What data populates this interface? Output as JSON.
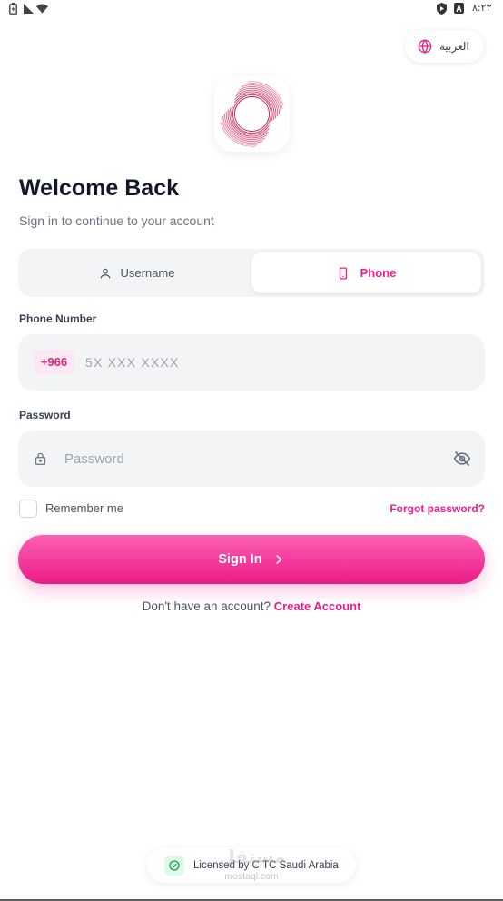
{
  "status_bar": {
    "time": "٨:٢٣",
    "left_icons": [
      "battery-charging-icon",
      "signal-icon",
      "wifi-icon"
    ],
    "right_icons": [
      "play-protect-icon",
      "autofill-icon"
    ]
  },
  "language_button": {
    "label": "العربية",
    "icon": "globe-icon"
  },
  "logo": {
    "icon": "swirl-logo-icon"
  },
  "header": {
    "title": "Welcome Back",
    "subtitle": "Sign in to continue to your account"
  },
  "login_tabs": [
    {
      "label": "Username",
      "icon": "user-icon",
      "active": false
    },
    {
      "label": "Phone",
      "icon": "smartphone-icon",
      "active": true
    }
  ],
  "phone_field": {
    "label": "Phone Number",
    "country_code": "+966",
    "placeholder": "5X XXX XXXX",
    "value": ""
  },
  "password_field": {
    "label": "Password",
    "placeholder": "Password",
    "value": "",
    "leading_icon": "lock-icon",
    "toggle_icon": "eye-off-icon"
  },
  "remember_me": {
    "label": "Remember me",
    "checked": false
  },
  "forgot_password": {
    "label": "Forgot password?"
  },
  "sign_in_button": {
    "label": "Sign In",
    "icon": "chevron-right-icon"
  },
  "signup_prompt": {
    "text": "Don't have an account?",
    "link_label": "Create Account"
  },
  "footer": {
    "license_text": "Licensed by CITC Saudi Arabia",
    "icon": "badge-check-icon"
  },
  "watermark": {
    "logo_text": "مستقل",
    "text": "mostaql.com"
  },
  "colors": {
    "accent": "#e91e8c",
    "accent_light": "#fce7f3",
    "accent_dark": "#db2777",
    "field_bg": "#f3f4f6",
    "text_primary": "#111827",
    "text_secondary": "#6b7280",
    "success": "#16a34a",
    "success_light": "#dcfce7"
  }
}
